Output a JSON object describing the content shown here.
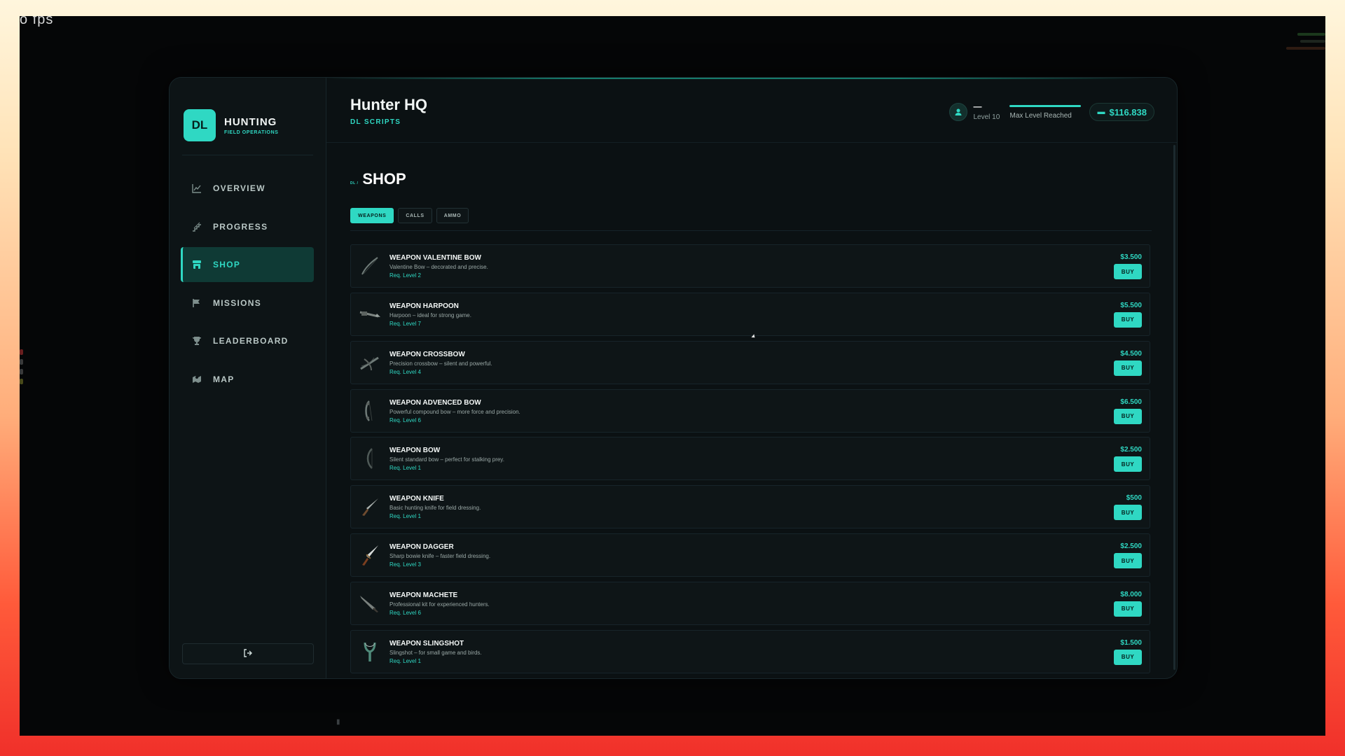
{
  "overlay": {
    "fps_text": "o fps"
  },
  "brand": {
    "logo": "DL",
    "title": "HUNTING",
    "subtitle": "FIELD OPERATIONS"
  },
  "nav": {
    "items": [
      {
        "label": "OVERVIEW",
        "icon": "chart-line-icon"
      },
      {
        "label": "PROGRESS",
        "icon": "stairs-icon"
      },
      {
        "label": "SHOP",
        "icon": "store-icon"
      },
      {
        "label": "MISSIONS",
        "icon": "flag-icon"
      },
      {
        "label": "LEADERBOARD",
        "icon": "trophy-icon"
      },
      {
        "label": "MAP",
        "icon": "map-icon"
      }
    ],
    "active": "SHOP",
    "logout_icon": "sign-out-icon"
  },
  "header": {
    "title": "Hunter HQ",
    "subtitle": "DL SCRIPTS",
    "user": {
      "name": "—",
      "level": "Level 10",
      "xp_label": "Max Level Reached",
      "xp_progress": 1.0
    },
    "money": "$116.838"
  },
  "page": {
    "crumb_prefix": "DL /",
    "title": "SHOP"
  },
  "tabs": [
    {
      "label": "WEAPONS",
      "active": true
    },
    {
      "label": "CALLS",
      "active": false
    },
    {
      "label": "AMMO",
      "active": false
    }
  ],
  "colors": {
    "accent": "#2fd8c3",
    "panel_bg": "#0b1113"
  },
  "items": [
    {
      "name": "WEAPON VALENTINE BOW",
      "desc": "Valentine Bow – decorated and precise.",
      "req": "Req. Level 2",
      "price": "$3.500",
      "buy": "BUY",
      "icon": "bow-icon"
    },
    {
      "name": "WEAPON HARPOON",
      "desc": "Harpoon – ideal for strong game.",
      "req": "Req. Level 7",
      "price": "$5.500",
      "buy": "BUY",
      "icon": "harpoon-icon"
    },
    {
      "name": "WEAPON CROSSBOW",
      "desc": "Precision crossbow – silent and powerful.",
      "req": "Req. Level 4",
      "price": "$4.500",
      "buy": "BUY",
      "icon": "crossbow-icon"
    },
    {
      "name": "WEAPON ADVENCED BOW",
      "desc": "Powerful compound bow – more force and precision.",
      "req": "Req. Level 6",
      "price": "$6.500",
      "buy": "BUY",
      "icon": "compound-bow-icon"
    },
    {
      "name": "WEAPON BOW",
      "desc": "Silent standard bow – perfect for stalking prey.",
      "req": "Req. Level 1",
      "price": "$2.500",
      "buy": "BUY",
      "icon": "bow-icon"
    },
    {
      "name": "WEAPON KNIFE",
      "desc": "Basic hunting knife for field dressing.",
      "req": "Req. Level 1",
      "price": "$500",
      "buy": "BUY",
      "icon": "knife-icon"
    },
    {
      "name": "WEAPON DAGGER",
      "desc": "Sharp bowie knife – faster field dressing.",
      "req": "Req. Level 3",
      "price": "$2.500",
      "buy": "BUY",
      "icon": "dagger-icon"
    },
    {
      "name": "WEAPON MACHETE",
      "desc": "Professional kit for experienced hunters.",
      "req": "Req. Level 6",
      "price": "$8.000",
      "buy": "BUY",
      "icon": "machete-icon"
    },
    {
      "name": "WEAPON SLINGSHOT",
      "desc": "Slingshot – for small game and birds.",
      "req": "Req. Level 1",
      "price": "$1.500",
      "buy": "BUY",
      "icon": "slingshot-icon"
    }
  ]
}
